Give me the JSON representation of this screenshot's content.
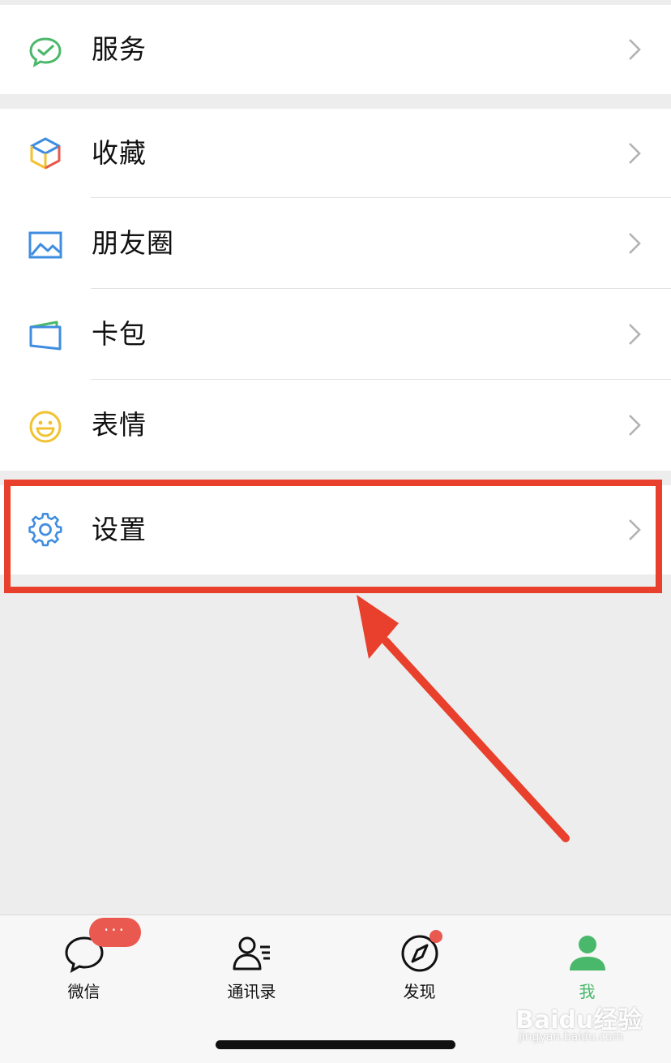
{
  "menu": {
    "group1": [
      {
        "label": "服务",
        "icon": "wechat-pay-service-icon"
      }
    ],
    "group2": [
      {
        "label": "收藏",
        "icon": "favorites-cube-icon"
      },
      {
        "label": "朋友圈",
        "icon": "moments-photo-icon"
      },
      {
        "label": "卡包",
        "icon": "card-wallet-icon"
      },
      {
        "label": "表情",
        "icon": "smiley-icon"
      }
    ],
    "group3": [
      {
        "label": "设置",
        "icon": "gear-icon"
      }
    ]
  },
  "tabbar": {
    "tabs": [
      {
        "label": "微信",
        "icon": "chat-bubble-icon"
      },
      {
        "label": "通讯录",
        "icon": "contacts-icon"
      },
      {
        "label": "发现",
        "icon": "compass-icon"
      },
      {
        "label": "我",
        "icon": "person-icon"
      }
    ],
    "badge": "···",
    "active_index": 3
  },
  "watermark": {
    "main": "Baidu经验",
    "sub": "jingyan.baidu.com"
  },
  "colors": {
    "accent_green": "#4ab86a",
    "highlight_red": "#e8402c",
    "badge_red": "#e9594f",
    "background": "#ededed"
  }
}
